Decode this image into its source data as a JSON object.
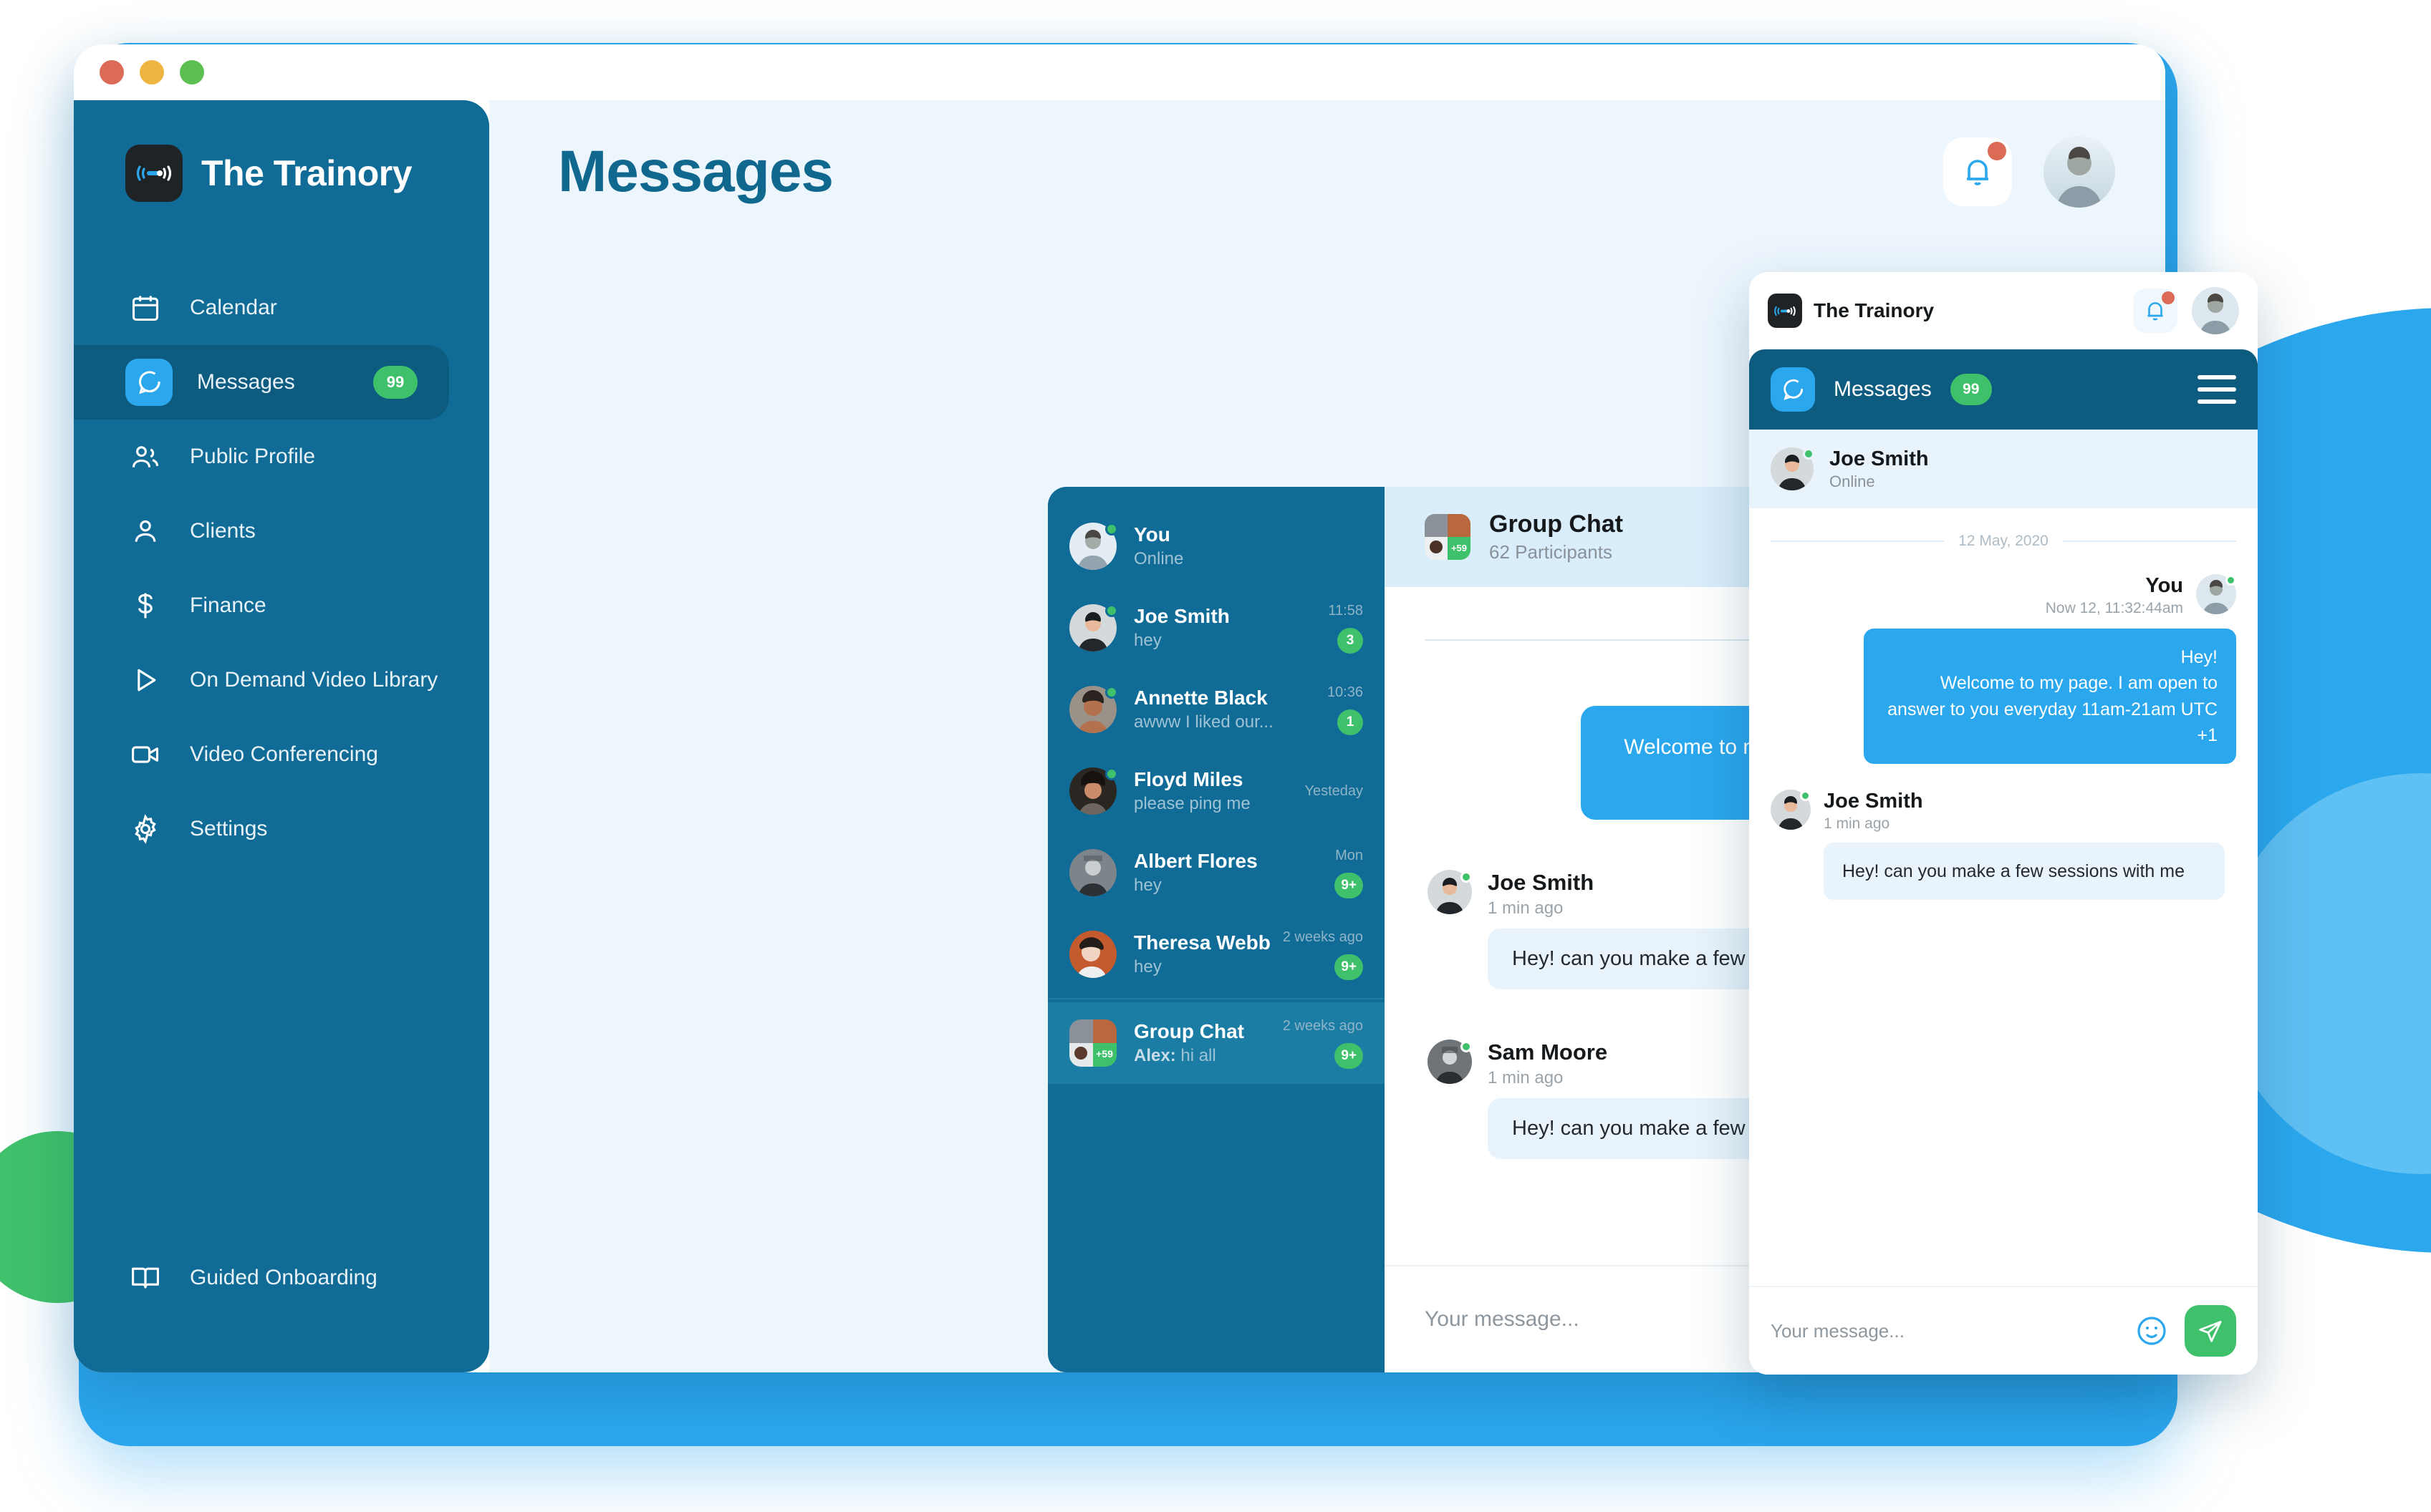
{
  "window": {
    "traffic_lights": [
      "close",
      "minimize",
      "maximize"
    ],
    "colors": {
      "close": "#DB6A56",
      "minimize": "#EEB543",
      "maximize": "#5CBF52"
    }
  },
  "brand": {
    "name": "The Trainory",
    "mark_icon": "broadcast-icon"
  },
  "sidebar": {
    "items": [
      {
        "label": "Calendar",
        "icon": "calendar-icon",
        "active": false,
        "badge": ""
      },
      {
        "label": "Messages",
        "icon": "chat-bubble-icon",
        "active": true,
        "badge": "99"
      },
      {
        "label": "Public Profile",
        "icon": "users-icon",
        "active": false,
        "badge": ""
      },
      {
        "label": "Clients",
        "icon": "user-icon",
        "active": false,
        "badge": ""
      },
      {
        "label": "Finance",
        "icon": "dollar-icon",
        "active": false,
        "badge": ""
      },
      {
        "label": "On Demand Video Library",
        "icon": "play-icon",
        "active": false,
        "badge": ""
      },
      {
        "label": "Video Conferencing",
        "icon": "video-camera-icon",
        "active": false,
        "badge": ""
      },
      {
        "label": "Settings",
        "icon": "gear-icon",
        "active": false,
        "badge": ""
      }
    ],
    "bottom_item": {
      "label": "Guided Onboarding",
      "icon": "book-icon"
    }
  },
  "header": {
    "title": "Messages",
    "bell_icon": "bell-icon",
    "bell_has_notification": true,
    "avatar_icon": "user-avatar"
  },
  "contacts": [
    {
      "name": "You",
      "preview": "Online",
      "preview_prefix": "",
      "time": "",
      "badge": "",
      "online": true,
      "selected": false,
      "avatar_kind": "circle"
    },
    {
      "name": "Joe Smith",
      "preview": "hey",
      "preview_prefix": "",
      "time": "11:58",
      "badge": "3",
      "online": true,
      "selected": false,
      "avatar_kind": "circle"
    },
    {
      "name": "Annette Black",
      "preview": "awww I liked our...",
      "preview_prefix": "",
      "time": "10:36",
      "badge": "1",
      "online": true,
      "selected": false,
      "avatar_kind": "circle"
    },
    {
      "name": "Floyd Miles",
      "preview": "please ping me",
      "preview_prefix": "",
      "time": "Yesteday",
      "badge": "",
      "online": true,
      "selected": false,
      "avatar_kind": "circle"
    },
    {
      "name": "Albert Flores",
      "preview": "hey",
      "preview_prefix": "",
      "time": "Mon",
      "badge": "9+",
      "online": false,
      "selected": false,
      "avatar_kind": "circle"
    },
    {
      "name": "Theresa Webb",
      "preview": "hey",
      "preview_prefix": "",
      "time": "2 weeks ago",
      "badge": "9+",
      "online": false,
      "selected": false,
      "avatar_kind": "circle"
    },
    {
      "name": "Group Chat",
      "preview": "hi all",
      "preview_prefix": "Alex:",
      "time": "2 weeks ago",
      "badge": "9+",
      "online": false,
      "selected": true,
      "avatar_kind": "group"
    }
  ],
  "chat": {
    "title": "Group Chat",
    "participants": "62 Participants",
    "group_avatar_overflow": "+59",
    "date_separator": "12 May, 2020",
    "messages": [
      {
        "direction": "out",
        "text": "Welcome to my page. I am open to answer to you everyday 11am-21am UTC +1"
      },
      {
        "direction": "in",
        "name": "Joe Smith",
        "time": "1 min ago",
        "text": "Hey! can you make a few sessions with me"
      },
      {
        "direction": "in",
        "name": "Sam Moore",
        "time": "1 min ago",
        "text": "Hey! can you make a few sessions with me"
      }
    ],
    "composer_placeholder": "Your message..."
  },
  "mobile": {
    "brand_name": "The Trainory",
    "bell_icon": "bell-icon",
    "bell_has_notification": true,
    "avatar_icon": "user-avatar",
    "nav": {
      "label": "Messages",
      "badge": "99",
      "icon": "chat-bubble-icon",
      "menu_icon": "hamburger-menu-icon"
    },
    "contact": {
      "name": "Joe Smith",
      "status": "Online",
      "online": true
    },
    "date_separator": "12 May, 2020",
    "messages": [
      {
        "direction": "out",
        "name": "You",
        "time": "Now 12, 11:32:44am",
        "line1": "Hey!",
        "line2": "Welcome to my page. I am open to answer to you everyday 11am-21am UTC +1"
      },
      {
        "direction": "in",
        "name": "Joe Smith",
        "time": "1 min ago",
        "text": "Hey! can you make a few sessions with me"
      }
    ],
    "composer_placeholder": "Your message...",
    "emoji_icon": "smiley-icon",
    "send_icon": "paper-plane-icon"
  },
  "theme": {
    "sidebar_bg": "#106C96",
    "sidebar_active_bg": "#0E5B80",
    "accent_blue": "#2BA7EE",
    "accent_green": "#3FC16B",
    "title_blue": "#11688F",
    "page_bg": "#EDF6FD",
    "bubble_in_bg": "#E8F3FB"
  }
}
